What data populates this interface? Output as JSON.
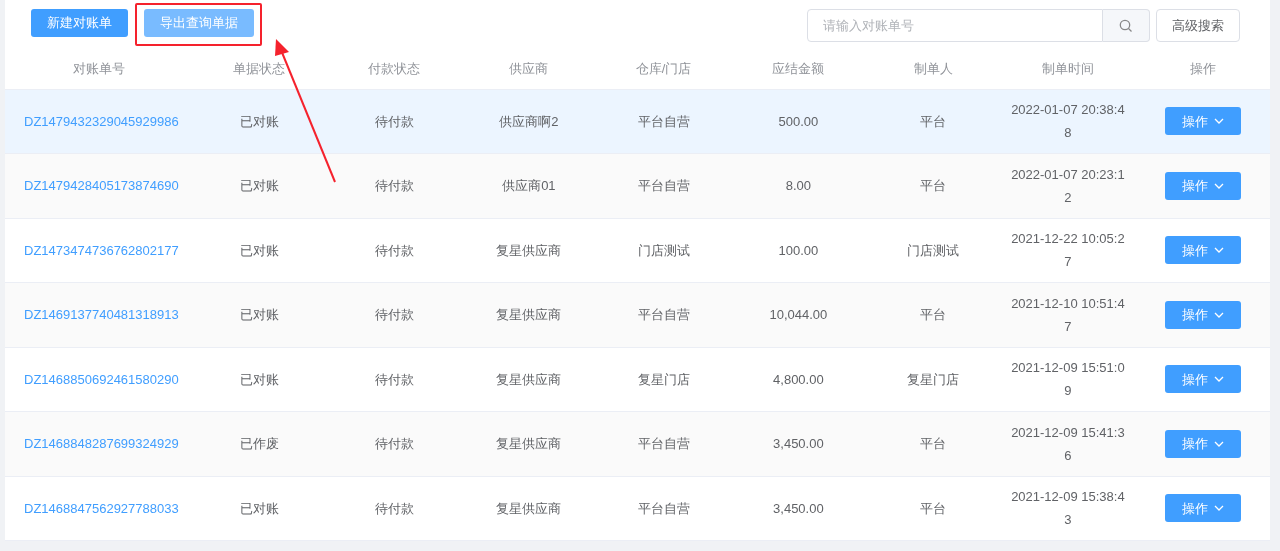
{
  "toolbar": {
    "buttons": [
      {
        "label": "新建对账单",
        "kind": "primary"
      },
      {
        "label": "导出查询单据",
        "kind": "light"
      }
    ],
    "search": {
      "placeholder": "请输入对账单号"
    },
    "advanced_button": "高级搜索"
  },
  "table": {
    "columns": [
      "对账单号",
      "单据状态",
      "付款状态",
      "供应商",
      "仓库/门店",
      "应结金额",
      "制单人",
      "制单时间",
      "操作"
    ],
    "rows": [
      {
        "id": "DZ1479432329045929986",
        "status": "已对账",
        "payment": "待付款",
        "supplier": "供应商啊2",
        "store": "平台自营",
        "amount": "500.00",
        "creator": "平台",
        "time": "2022-01-07 20:38:48",
        "action": "操作",
        "selected": true
      },
      {
        "id": "DZ1479428405173874690",
        "status": "已对账",
        "payment": "待付款",
        "supplier": "供应商01",
        "store": "平台自营",
        "amount": "8.00",
        "creator": "平台",
        "time": "2022-01-07 20:23:12",
        "action": "操作",
        "selected": false
      },
      {
        "id": "DZ1473474736762802177",
        "status": "已对账",
        "payment": "待付款",
        "supplier": "复星供应商",
        "store": "门店测试",
        "amount": "100.00",
        "creator": "门店测试",
        "time": "2021-12-22 10:05:27",
        "action": "操作",
        "selected": false
      },
      {
        "id": "DZ1469137740481318913",
        "status": "已对账",
        "payment": "待付款",
        "supplier": "复星供应商",
        "store": "平台自营",
        "amount": "10,044.00",
        "creator": "平台",
        "time": "2021-12-10 10:51:47",
        "action": "操作",
        "selected": false
      },
      {
        "id": "DZ1468850692461580290",
        "status": "已对账",
        "payment": "待付款",
        "supplier": "复星供应商",
        "store": "复星门店",
        "amount": "4,800.00",
        "creator": "复星门店",
        "time": "2021-12-09 15:51:09",
        "action": "操作",
        "selected": false
      },
      {
        "id": "DZ1468848287699324929",
        "status": "已作废",
        "payment": "待付款",
        "supplier": "复星供应商",
        "store": "平台自营",
        "amount": "3,450.00",
        "creator": "平台",
        "time": "2021-12-09 15:41:36",
        "action": "操作",
        "selected": false
      },
      {
        "id": "DZ1468847562927788033",
        "status": "已对账",
        "payment": "待付款",
        "supplier": "复星供应商",
        "store": "平台自营",
        "amount": "3,450.00",
        "creator": "平台",
        "time": "2021-12-09 15:38:43",
        "action": "操作",
        "selected": false
      }
    ]
  }
}
